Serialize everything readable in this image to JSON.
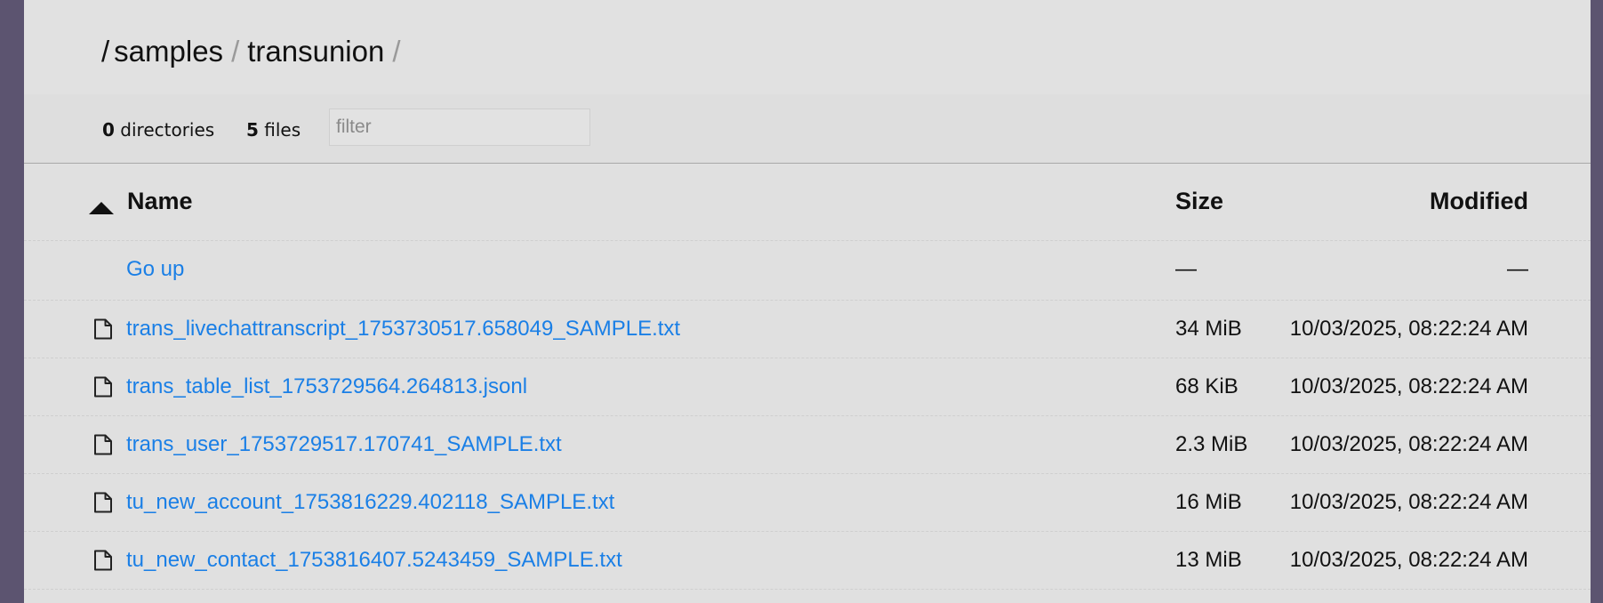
{
  "breadcrumb": {
    "root_sep": "/",
    "items": [
      {
        "label": "samples"
      },
      {
        "label": "transunion"
      }
    ],
    "sep": "/"
  },
  "summary": {
    "directories_count": "0",
    "directories_label": "directories",
    "files_count": "5",
    "files_label": "files",
    "filter_placeholder": "filter"
  },
  "table": {
    "headers": {
      "name": "Name",
      "size": "Size",
      "modified": "Modified"
    },
    "go_up": {
      "label": "Go up",
      "size": "—",
      "modified": "—"
    },
    "rows": [
      {
        "name": "trans_livechattranscript_1753730517.658049_SAMPLE.txt",
        "size": "34 MiB",
        "modified": "10/03/2025, 08:22:24 AM",
        "icon": "file-icon"
      },
      {
        "name": "trans_table_list_1753729564.264813.jsonl",
        "size": "68 KiB",
        "modified": "10/03/2025, 08:22:24 AM",
        "icon": "file-icon"
      },
      {
        "name": "trans_user_1753729517.170741_SAMPLE.txt",
        "size": "2.3 MiB",
        "modified": "10/03/2025, 08:22:24 AM",
        "icon": "file-icon"
      },
      {
        "name": "tu_new_account_1753816229.402118_SAMPLE.txt",
        "size": "16 MiB",
        "modified": "10/03/2025, 08:22:24 AM",
        "icon": "file-icon"
      },
      {
        "name": "tu_new_contact_1753816407.5243459_SAMPLE.txt",
        "size": "13 MiB",
        "modified": "10/03/2025, 08:22:24 AM",
        "icon": "file-icon"
      }
    ]
  },
  "colors": {
    "link": "#1a7fe6",
    "background_outer": "#5c5470",
    "panel": "#e0e0e0"
  }
}
